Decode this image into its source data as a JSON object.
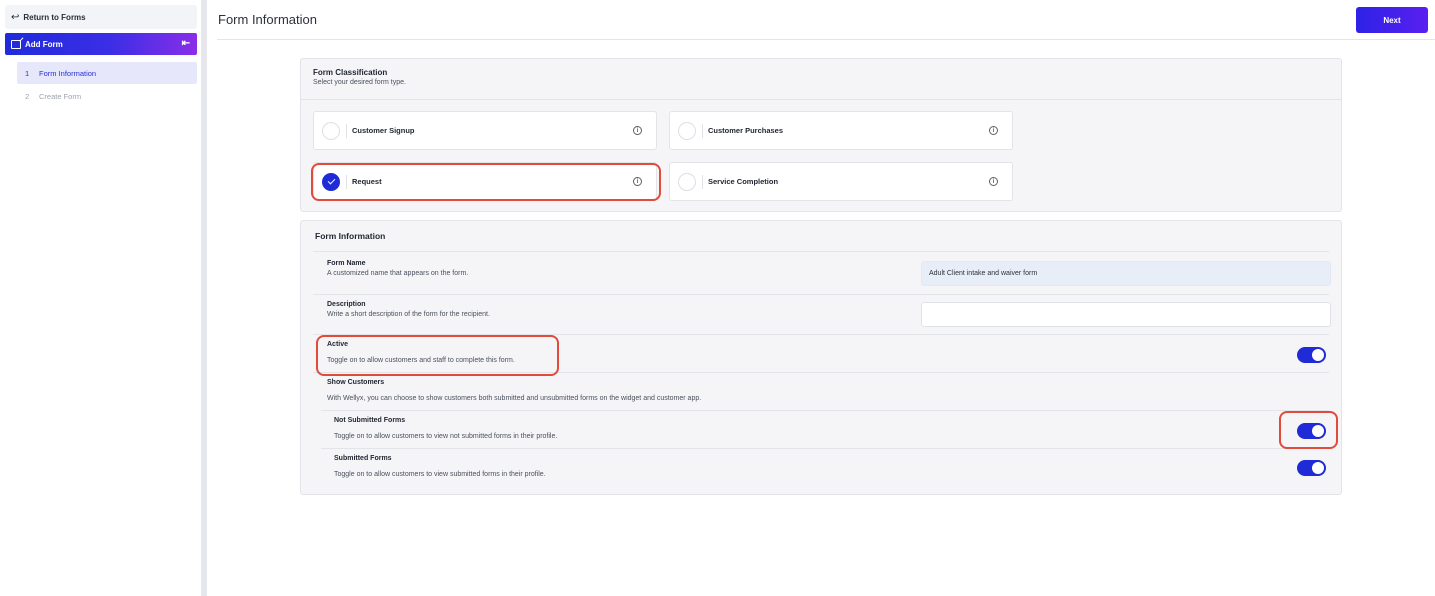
{
  "sidebar": {
    "return_label": "Return to Forms",
    "add_form_label": "Add Form",
    "steps": [
      {
        "num": "1",
        "label": "Form Information"
      },
      {
        "num": "2",
        "label": "Create Form"
      }
    ]
  },
  "header": {
    "title": "Form Information",
    "next_label": "Next"
  },
  "classification": {
    "title": "Form Classification",
    "subtitle": "Select your desired form type.",
    "options": [
      {
        "label": "Customer Signup",
        "selected": false
      },
      {
        "label": "Customer Purchases",
        "selected": false
      },
      {
        "label": "Request",
        "selected": true
      },
      {
        "label": "Service Completion",
        "selected": false
      }
    ]
  },
  "form_info": {
    "title": "Form Information",
    "form_name": {
      "label": "Form Name",
      "desc": "A customized name that appears on the form.",
      "value": "Adult Client intake and waiver form"
    },
    "description": {
      "label": "Description",
      "desc": "Write a short description of the form for the recipient.",
      "value": ""
    },
    "active": {
      "label": "Active",
      "desc": "Toggle on to allow customers and staff to complete this form.",
      "on": true
    },
    "show_customers": {
      "label": "Show Customers",
      "desc": "With Wellyx, you can choose to show customers both submitted and unsubmitted forms on the widget and customer app."
    },
    "not_submitted": {
      "label": "Not Submitted Forms",
      "desc": "Toggle on to allow customers to view not submitted forms in their profile.",
      "on": true
    },
    "submitted": {
      "label": "Submitted Forms",
      "desc": "Toggle on to allow customers to view submitted forms in their profile.",
      "on": true
    }
  },
  "colors": {
    "accent": "#1e2bd6",
    "highlight": "#e04b3a"
  }
}
